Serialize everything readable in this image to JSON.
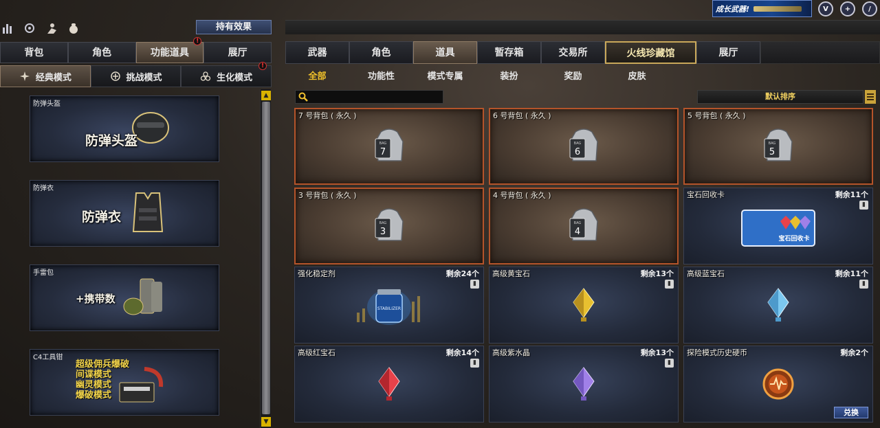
{
  "top": {
    "effect_button": "持有效果",
    "promo_text": "成长武器!",
    "icons": [
      "ranking-icon",
      "refresh-icon",
      "character-icon",
      "bag-icon"
    ],
    "corner_icons": [
      "vip-v-icon",
      "crosshair-icon",
      "sword-icon"
    ]
  },
  "left_tabs": [
    {
      "label": "背包",
      "active": false
    },
    {
      "label": "角色",
      "active": false
    },
    {
      "label": "功能道具",
      "active": true,
      "alert": "!"
    },
    {
      "label": "展厅",
      "active": false
    }
  ],
  "mode_tabs": [
    {
      "label": "经典模式",
      "icon": "star-icon",
      "active": true
    },
    {
      "label": "挑战模式",
      "icon": "swords-icon",
      "active": false
    },
    {
      "label": "生化模式",
      "icon": "biohazard-icon",
      "active": false,
      "alert": "!"
    }
  ],
  "equipment": [
    {
      "title": "防弹头盔",
      "big_text": "防弹头盔",
      "icon": "helmet-icon"
    },
    {
      "title": "防弹衣",
      "big_text": "防弹衣",
      "icon": "vest-icon"
    },
    {
      "title": "手雷包",
      "big_text": "+携带数",
      "icon": "grenade-icon"
    },
    {
      "title": "C4工具钳",
      "modes": [
        "超级佣兵爆破",
        "间谍模式",
        "幽灵模式",
        "爆破模式"
      ],
      "icon": "c4-icon"
    }
  ],
  "main_tabs": [
    {
      "label": "武器",
      "active": false
    },
    {
      "label": "角色",
      "active": false
    },
    {
      "label": "道具",
      "active": true
    },
    {
      "label": "暂存箱",
      "active": false
    },
    {
      "label": "交易所",
      "active": false
    },
    {
      "label": "火线珍藏馆",
      "active": false,
      "special": true
    },
    {
      "label": "展厅",
      "active": false
    }
  ],
  "sub_tabs": [
    {
      "label": "全部",
      "active": true
    },
    {
      "label": "功能性",
      "active": false
    },
    {
      "label": "模式专属",
      "active": false
    },
    {
      "label": "装扮",
      "active": false
    },
    {
      "label": "奖励",
      "active": false
    },
    {
      "label": "皮肤",
      "active": false
    }
  ],
  "search": {
    "placeholder": ""
  },
  "sort": {
    "label": "默认排序"
  },
  "items": [
    {
      "name": "7 号背包 ( 永久 )",
      "type": "bag",
      "num": "7",
      "remain": ""
    },
    {
      "name": "6 号背包 ( 永久 )",
      "type": "bag",
      "num": "6",
      "remain": ""
    },
    {
      "name": "5 号背包 ( 永久 )",
      "type": "bag",
      "num": "5",
      "remain": ""
    },
    {
      "name": "3 号背包 ( 永久 )",
      "type": "bag",
      "num": "3",
      "remain": ""
    },
    {
      "name": "4 号背包 ( 永久 )",
      "type": "bag",
      "num": "4",
      "remain": ""
    },
    {
      "name": "宝石回收卡",
      "type": "card",
      "remain": "剩余11个",
      "card_text": "宝石回收卡"
    },
    {
      "name": "强化稳定剂",
      "type": "stabilizer",
      "remain": "剩余24个",
      "jar_text": "STABILIZER"
    },
    {
      "name": "高级黄宝石",
      "type": "gem",
      "gem_color": "#e8c030",
      "remain": "剩余13个"
    },
    {
      "name": "高级蓝宝石",
      "type": "gem",
      "gem_color": "#7cc8f0",
      "remain": "剩余11个"
    },
    {
      "name": "高级红宝石",
      "type": "gem",
      "gem_color": "#e8424a",
      "remain": "剩余14个"
    },
    {
      "name": "高级紫水晶",
      "type": "gem",
      "gem_color": "#a080e8",
      "remain": "剩余13个"
    },
    {
      "name": "探险模式历史硬币",
      "type": "coin",
      "remain": "剩余2个",
      "button": "兑换"
    }
  ]
}
